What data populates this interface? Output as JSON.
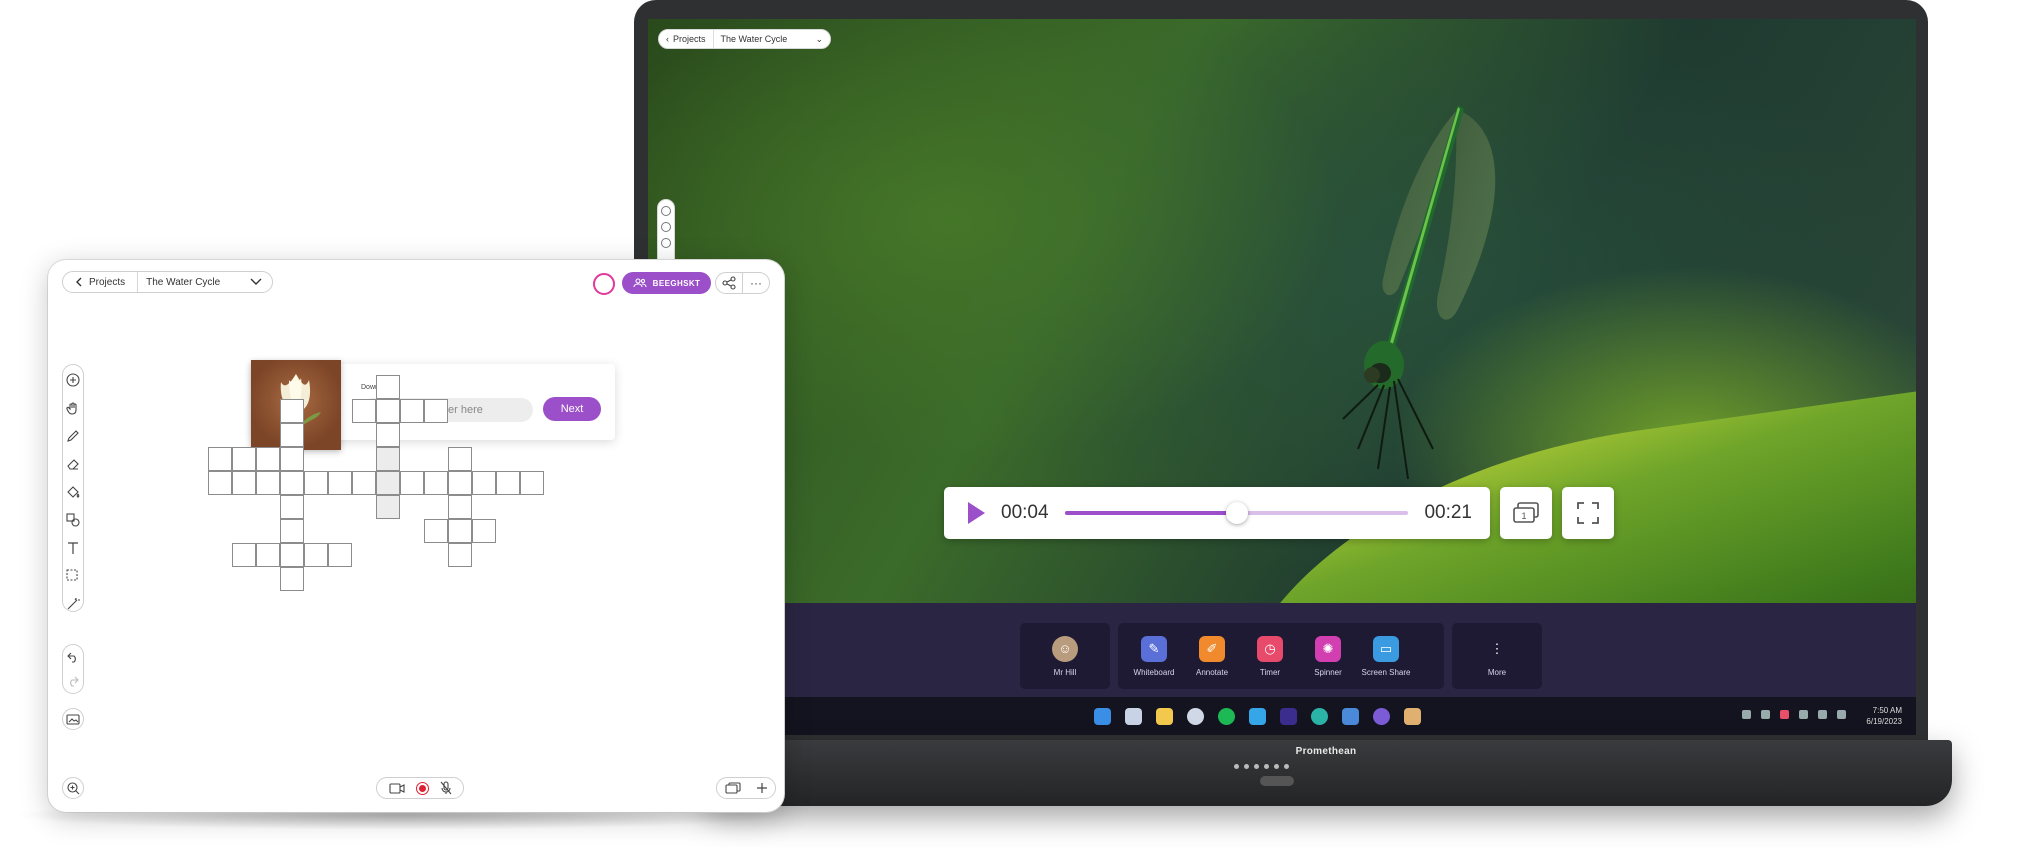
{
  "display": {
    "brand": "Promethean",
    "header": {
      "back_label": "Projects",
      "project": "The Water Cycle"
    },
    "player": {
      "current_time": "00:04",
      "duration": "00:21",
      "progress": 0.5,
      "screens_count": "1"
    },
    "dock": {
      "teacher": {
        "label": "Mr Hill"
      },
      "apps": [
        {
          "label": "Whiteboard",
          "icon": "whiteboard-icon",
          "color": "#5b6fd8"
        },
        {
          "label": "Annotate",
          "icon": "annotate-icon",
          "color": "#f08a2c"
        },
        {
          "label": "Timer",
          "icon": "timer-icon",
          "color": "#e84a6b"
        },
        {
          "label": "Spinner",
          "icon": "spinner-icon",
          "color": "#d23fb0"
        },
        {
          "label": "Screen Share",
          "icon": "screen-share-icon",
          "color": "#3a9be0"
        }
      ],
      "more": {
        "label": "More"
      }
    },
    "taskbar": {
      "time": "7:50 AM",
      "date": "6/19/2023"
    }
  },
  "tablet": {
    "header": {
      "back_label": "Projects",
      "project": "The Water Cycle"
    },
    "code_button": "BEEGHSKT",
    "accent": "#9b4fc9",
    "clue": {
      "label": "Down (6)",
      "input_placeholder": "Type your answer here",
      "next_label": "Next"
    }
  }
}
